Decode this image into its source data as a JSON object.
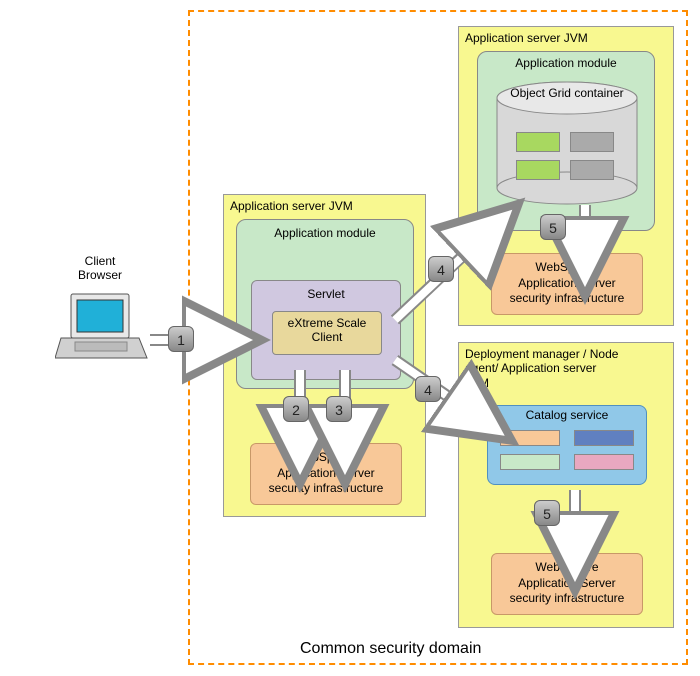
{
  "client_label": "Client\nBrowser",
  "domain_label": "Common security domain",
  "jvm_left": {
    "title": "Application server JVM",
    "module": "Application module",
    "servlet": "Servlet",
    "xs_client": "eXtreme Scale\nClient",
    "was": "WebSphere\nApplication Server\nsecurity infrastructure"
  },
  "jvm_top": {
    "title": "Application server JVM",
    "module": "Application module",
    "ogc": "Object Grid container",
    "was": "WebSphere\nApplication Server\nsecurity infrastructure"
  },
  "jvm_bottom": {
    "title": "Deployment manager / Node\nagent/ Application server\nJVM",
    "catalog": "Catalog service",
    "was": "WebSphere\nApplication Server\nsecurity infrastructure"
  },
  "steps": {
    "s1": "1",
    "s2": "2",
    "s3": "3",
    "s4a": "4",
    "s4b": "4",
    "s5a": "5",
    "s5b": "5"
  }
}
